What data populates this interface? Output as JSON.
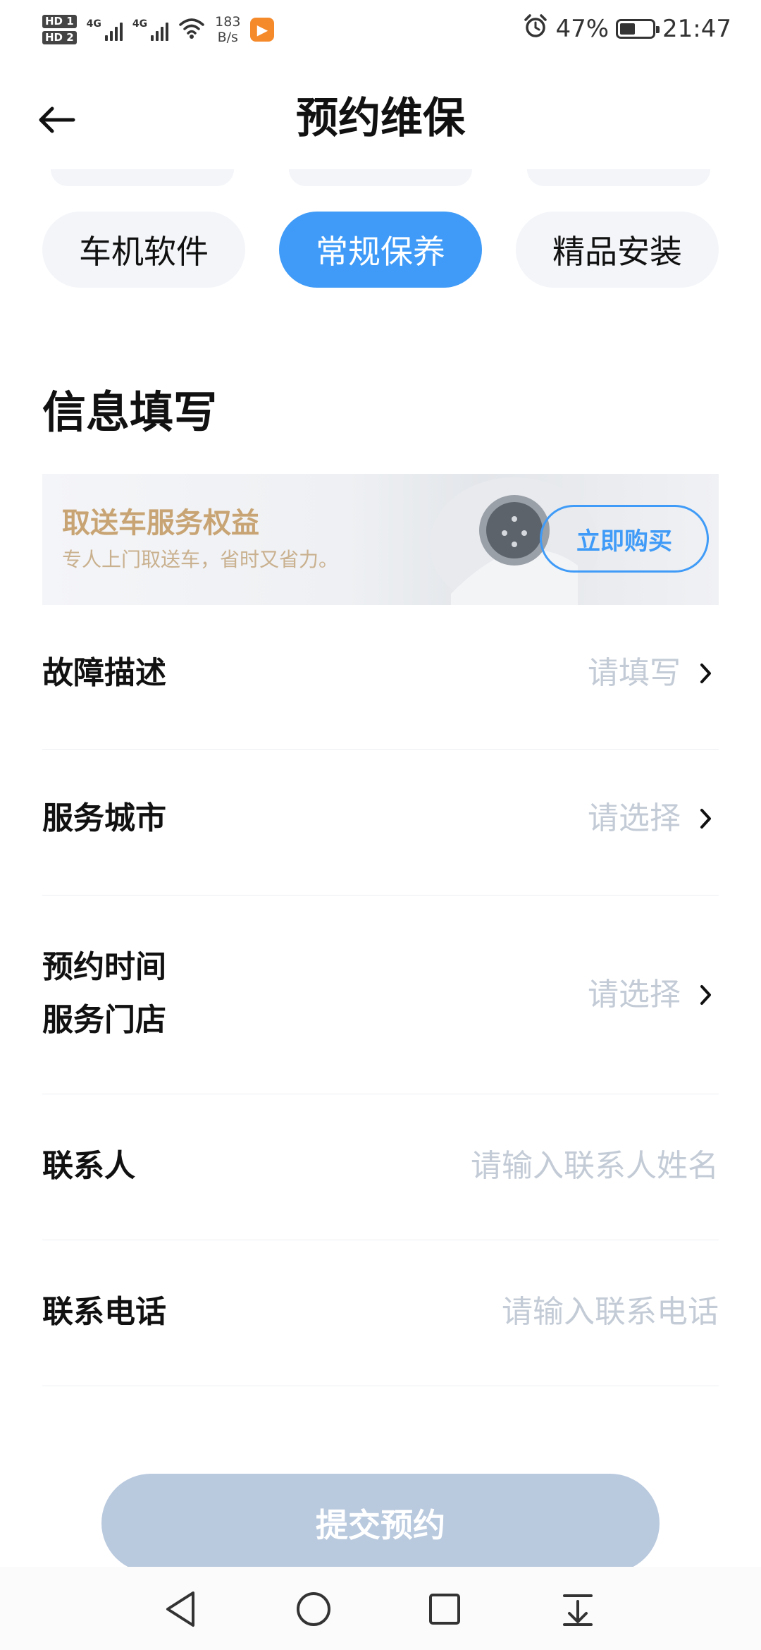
{
  "status_bar": {
    "hd1": "HD 1",
    "hd2": "HD 2",
    "net1": "4G",
    "net2": "4G",
    "net_speed_value": "183",
    "net_speed_unit": "B/s",
    "battery_percent": "47%",
    "battery_level": 0.47,
    "time": "21:47"
  },
  "header": {
    "title": "预约维保"
  },
  "service_chips": [
    {
      "label": "车机软件",
      "active": false
    },
    {
      "label": "常规保养",
      "active": true
    },
    {
      "label": "精品安装",
      "active": false
    }
  ],
  "section_title": "信息填写",
  "banner": {
    "title": "取送车服务权益",
    "subtitle": "专人上门取送车，省时又省力。",
    "button_label": "立即购买"
  },
  "form": {
    "fault": {
      "label": "故障描述",
      "placeholder": "请填写"
    },
    "city": {
      "label": "服务城市",
      "placeholder": "请选择"
    },
    "time_store": {
      "label_line1": "预约时间",
      "label_line2": "服务门店",
      "placeholder": "请选择"
    },
    "contact": {
      "label": "联系人",
      "placeholder": "请输入联系人姓名"
    },
    "phone": {
      "label": "联系电话",
      "placeholder": "请输入联系电话"
    }
  },
  "submit_label": "提交预约",
  "colors": {
    "accent": "#3f9bf7",
    "chip_bg": "#f3f5f9",
    "placeholder": "#c3cbd6",
    "banner_title": "#c8a474",
    "submit_disabled": "#b9c9de"
  }
}
